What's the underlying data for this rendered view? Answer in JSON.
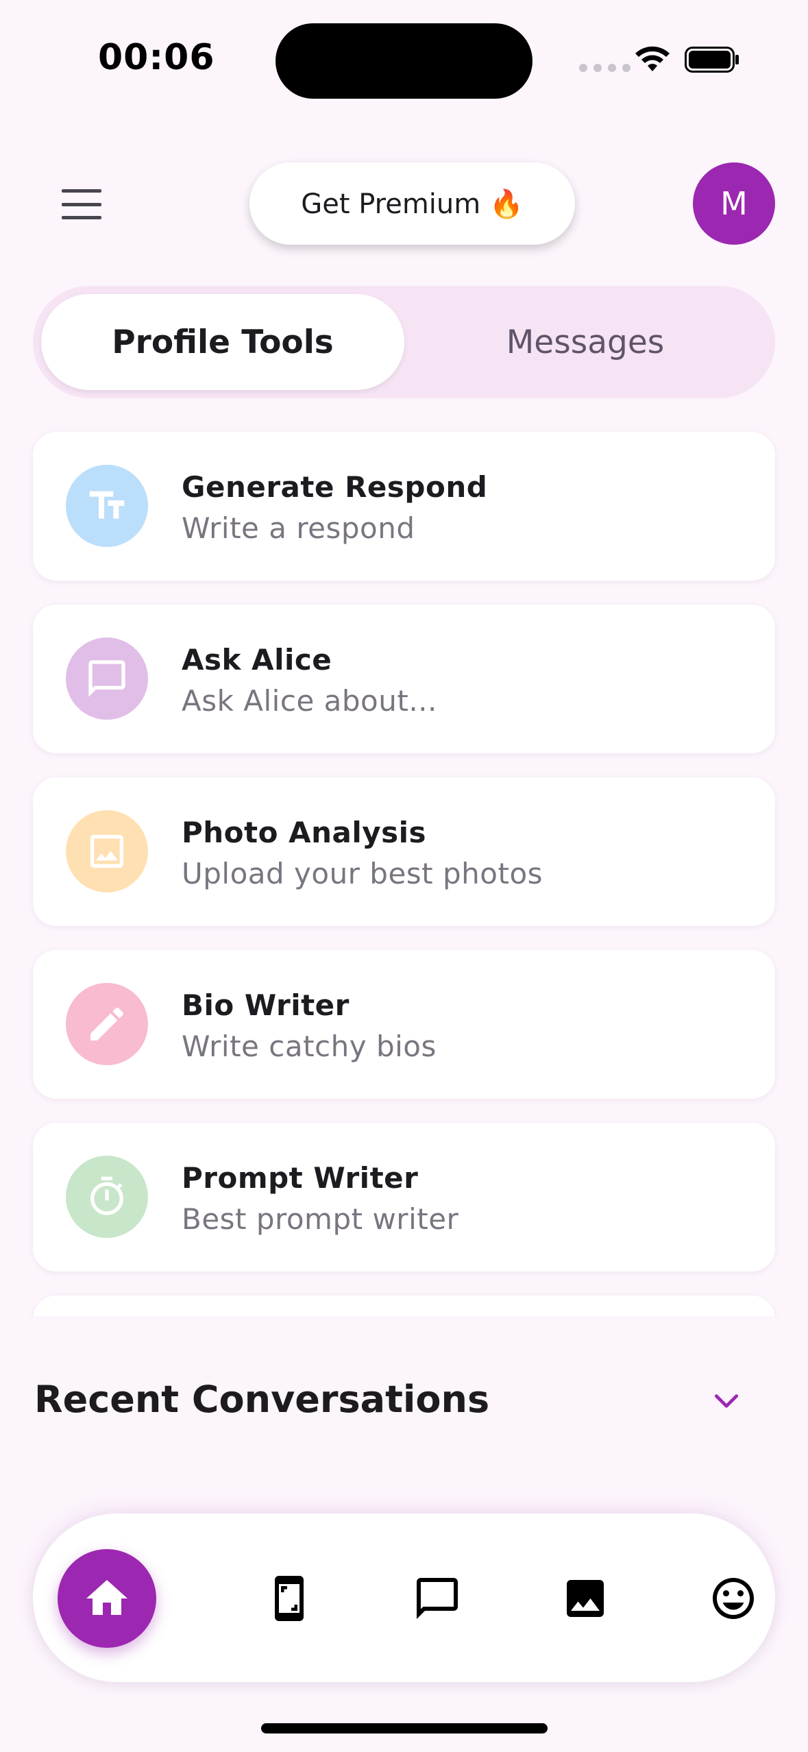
{
  "status_bar": {
    "time": "00:06"
  },
  "header": {
    "premium_label": "Get Premium 🔥",
    "avatar_initial": "M"
  },
  "tabs": [
    {
      "label": "Profile Tools",
      "active": true
    },
    {
      "label": "Messages",
      "active": false
    }
  ],
  "tools": [
    {
      "title": "Generate Respond",
      "subtitle": "Write a respond",
      "icon": "text-format-icon",
      "color": "#bbdefb",
      "icon_color": "#ffffff"
    },
    {
      "title": "Ask Alice",
      "subtitle": "Ask Alice about...",
      "icon": "chat-bubble-icon",
      "color": "#e1bee7",
      "icon_color": "#ffffff"
    },
    {
      "title": "Photo Analysis",
      "subtitle": "Upload your best photos",
      "icon": "image-icon",
      "color": "#ffe0b2",
      "icon_color": "#ffffff"
    },
    {
      "title": "Bio Writer",
      "subtitle": "Write catchy bios",
      "icon": "pencil-icon",
      "color": "#f8bbd0",
      "icon_color": "#ffffff"
    },
    {
      "title": "Prompt Writer",
      "subtitle": "Best prompt writer",
      "icon": "timer-icon",
      "color": "#c8e6c9",
      "icon_color": "#ffffff"
    }
  ],
  "recent": {
    "title": "Recent Conversations"
  },
  "bottom_nav": [
    {
      "icon": "home-icon",
      "active": true
    },
    {
      "icon": "phone-screenshot-icon",
      "active": false
    },
    {
      "icon": "chat-bubble-icon",
      "active": false
    },
    {
      "icon": "image-icon",
      "active": false
    },
    {
      "icon": "smiley-icon",
      "active": false
    }
  ],
  "colors": {
    "accent": "#9c27b0",
    "background": "#fcf5fc",
    "tab_track": "#f6e4f5"
  }
}
